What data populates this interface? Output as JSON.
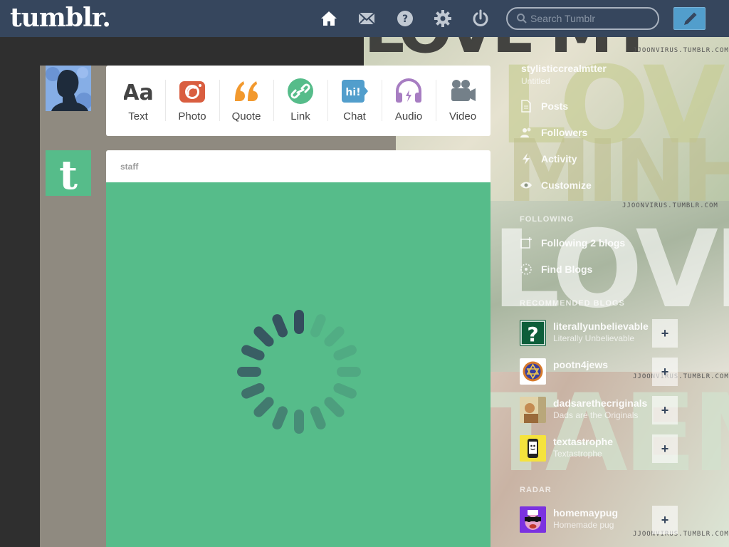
{
  "topbar": {
    "logo": "tumblr.",
    "search_placeholder": "Search Tumblr",
    "nav": [
      "home-icon",
      "inbox-icon",
      "help-icon",
      "settings-icon",
      "logout-icon",
      "compose-icon"
    ]
  },
  "post_types": [
    {
      "label": "Text",
      "icon": "text-icon",
      "color": "#444444"
    },
    {
      "label": "Photo",
      "icon": "camera-icon",
      "color": "#d95e40"
    },
    {
      "label": "Quote",
      "icon": "quote-icon",
      "color": "#f2992e"
    },
    {
      "label": "Link",
      "icon": "link-icon",
      "color": "#56bc8a"
    },
    {
      "label": "Chat",
      "icon": "chat-icon",
      "color": "#529ecc"
    },
    {
      "label": "Audio",
      "icon": "headphones-icon",
      "color": "#a77dc2"
    },
    {
      "label": "Video",
      "icon": "video-camera-icon",
      "color": "#748089"
    }
  ],
  "post": {
    "author": "staff",
    "background": "#56bc8a"
  },
  "sidebar": {
    "blog_name": "stylisticcrealmtter",
    "blog_sub": "Untitled",
    "menu": [
      {
        "label": "Posts",
        "icon": "document-icon"
      },
      {
        "label": "Followers",
        "icon": "followers-icon"
      },
      {
        "label": "Activity",
        "icon": "activity-icon"
      },
      {
        "label": "Customize",
        "icon": "eye-icon"
      }
    ],
    "following_heading": "FOLLOWING",
    "following": [
      {
        "label": "Following 2 blogs",
        "icon": "following-icon"
      },
      {
        "label": "Find Blogs",
        "icon": "compass-icon"
      }
    ],
    "recommended_heading": "RECOMMENDED BLOGS",
    "recommended": [
      {
        "name": "literallyunbelievable",
        "sub": "Literally Unbelievable"
      },
      {
        "name": "pootn4jews",
        "sub": ""
      },
      {
        "name": "dadsarethecriginals",
        "sub": "Dads are the Originals"
      },
      {
        "name": "textastrophe",
        "sub": "Textastrophe"
      }
    ],
    "radar_heading": "RADAR",
    "radar": [
      {
        "name": "homemaypug",
        "sub": "Homemade pug"
      }
    ],
    "follow_symbol": "+"
  },
  "background": {
    "watermark": "JJOONVIRUS.TUMBLR.COM",
    "words": [
      "LOVE MY",
      "MINHO",
      "LOVE MY",
      "TAEMIN",
      "LOVE MY"
    ]
  }
}
